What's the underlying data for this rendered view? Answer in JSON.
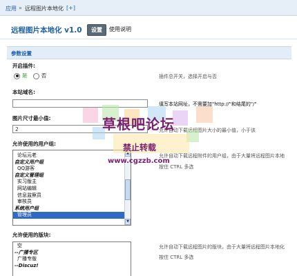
{
  "breadcrumb": {
    "home": "应用",
    "separator": "»",
    "current": "远程图片本地化",
    "add": "[+]"
  },
  "header": {
    "title": "远程图片本地化 v1.0",
    "settings_button": "设置",
    "help_link": "使用说明"
  },
  "section": {
    "title": "参数设置"
  },
  "enable": {
    "label": "开启插件:",
    "yes": "是",
    "no": "否",
    "selected": "是",
    "desc": "插件总开关，选择开启与否"
  },
  "domain": {
    "label": "本站域名:",
    "value": "",
    "desc": "填写本站网址，不需要加\"http://\"和结尾的\"/\""
  },
  "min_size": {
    "label": "图片尺寸最小值:",
    "value": "2",
    "desc": "允许自动下载远程图片大小的最小值，小于该"
  },
  "groups": {
    "label": "允许使用的用户组:",
    "desc_line1": "允许自动下载远程附件的用户组，由于大量将远程图片本地",
    "desc_line2": "按住 CTRL 多选",
    "options": [
      {
        "text": "论坛元老",
        "group": false,
        "selected": false
      },
      {
        "text": "自定义用户组",
        "group": true,
        "selected": false
      },
      {
        "text": "QQ游客",
        "group": false,
        "selected": false
      },
      {
        "text": "自定义管理组",
        "group": true,
        "selected": false
      },
      {
        "text": "实习版主",
        "group": false,
        "selected": false
      },
      {
        "text": "网站编辑",
        "group": false,
        "selected": false
      },
      {
        "text": "信息监察员",
        "group": false,
        "selected": false
      },
      {
        "text": "审核员",
        "group": false,
        "selected": false
      },
      {
        "text": "系统用户组",
        "group": true,
        "selected": false
      },
      {
        "text": "管理员",
        "group": false,
        "selected": true
      }
    ]
  },
  "forums": {
    "label": "允许使用的版块:",
    "desc_line1": "允许自动下载远程图片的版块，由于大量将远程图片本地化",
    "desc_line2": "按住 CTRL 多选",
    "options": [
      {
        "text": "空",
        "group": false
      },
      {
        "text": "--广播专区",
        "group": true
      },
      {
        "text": "广播专版",
        "group": false
      },
      {
        "text": "--Discuz!",
        "group": true
      }
    ]
  },
  "watermark": {
    "title": "草根吧论坛",
    "subtitle": "禁止转载",
    "url": "www.cgzzb.com"
  },
  "colors": {
    "accent": "#1e5fa6",
    "selection": "#316ac5",
    "section_bg": "#e3edf7"
  }
}
